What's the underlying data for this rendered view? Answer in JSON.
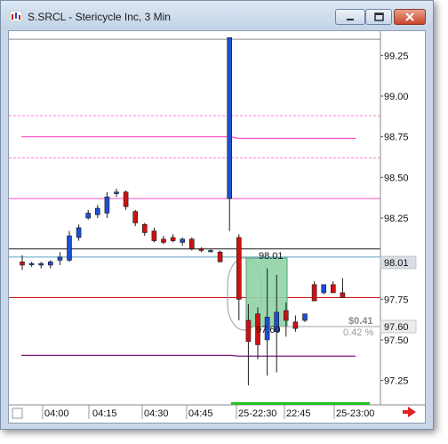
{
  "window": {
    "title": "S.SRCL - Stericycle Inc, 3 Min"
  },
  "price_axis": {
    "ticks": [
      "99.25",
      "99.00",
      "98.75",
      "98.50",
      "98.25",
      "97.75",
      "97.50",
      "97.25"
    ],
    "tick_values": [
      99.25,
      99.0,
      98.75,
      98.5,
      98.25,
      97.75,
      97.5,
      97.25
    ],
    "current_price": "98.01",
    "current_value": 98.01,
    "marker_price": "97.60",
    "marker_value": 97.6
  },
  "time_axis": {
    "labels": [
      "04:00",
      "04:15",
      "04:30",
      "04:45",
      "25-22:30",
      "22:45",
      "25-23:00"
    ]
  },
  "measure": {
    "price_label": "98.01",
    "end_label": "97.60",
    "change_label": "$0.41",
    "percent_label": "0.42 %"
  },
  "colors": {
    "up": "#1f4fcf",
    "down": "#cc1111",
    "magenta_line": "#ff4cc4",
    "red_line": "#cc1111",
    "purple_line": "#7b1a7b",
    "measure_fill": "#8fd3a6"
  },
  "chart_data": {
    "type": "candlestick",
    "title": "S.SRCL - Stericycle Inc, 3 Min",
    "ylim": [
      97.1,
      99.4
    ],
    "candles": [
      {
        "o": 97.98,
        "h": 98.02,
        "l": 97.93,
        "c": 97.96
      },
      {
        "o": 97.97,
        "h": 97.98,
        "l": 97.95,
        "c": 97.97
      },
      {
        "o": 97.96,
        "h": 97.98,
        "l": 97.94,
        "c": 97.97
      },
      {
        "o": 97.96,
        "h": 97.99,
        "l": 97.94,
        "c": 97.98
      },
      {
        "o": 97.99,
        "h": 98.04,
        "l": 97.96,
        "c": 98.01
      },
      {
        "o": 97.99,
        "h": 98.17,
        "l": 97.98,
        "c": 98.14
      },
      {
        "o": 98.13,
        "h": 98.21,
        "l": 98.11,
        "c": 98.19
      },
      {
        "o": 98.25,
        "h": 98.3,
        "l": 98.24,
        "c": 98.28
      },
      {
        "o": 98.27,
        "h": 98.33,
        "l": 98.25,
        "c": 98.31
      },
      {
        "o": 98.28,
        "h": 98.41,
        "l": 98.25,
        "c": 98.38
      },
      {
        "o": 98.4,
        "h": 98.43,
        "l": 98.38,
        "c": 98.41
      },
      {
        "o": 98.41,
        "h": 98.42,
        "l": 98.3,
        "c": 98.32
      },
      {
        "o": 98.29,
        "h": 98.3,
        "l": 98.2,
        "c": 98.22
      },
      {
        "o": 98.21,
        "h": 98.22,
        "l": 98.14,
        "c": 98.16
      },
      {
        "o": 98.17,
        "h": 98.19,
        "l": 98.1,
        "c": 98.11
      },
      {
        "o": 98.12,
        "h": 98.14,
        "l": 98.09,
        "c": 98.1
      },
      {
        "o": 98.13,
        "h": 98.15,
        "l": 98.1,
        "c": 98.11
      },
      {
        "o": 98.1,
        "h": 98.13,
        "l": 98.08,
        "c": 98.12
      },
      {
        "o": 98.12,
        "h": 98.13,
        "l": 98.05,
        "c": 98.06
      },
      {
        "o": 98.06,
        "h": 98.07,
        "l": 98.04,
        "c": 98.05
      },
      {
        "o": 98.05,
        "h": 98.06,
        "l": 98.04,
        "c": 98.05
      },
      {
        "o": 98.04,
        "h": 98.05,
        "l": 97.98,
        "c": 97.98
      },
      {
        "o": 98.37,
        "h": 99.36,
        "l": 98.17,
        "c": 99.36
      },
      {
        "o": 98.13,
        "h": 98.15,
        "l": 97.62,
        "c": 97.75
      },
      {
        "o": 97.62,
        "h": 97.72,
        "l": 97.22,
        "c": 97.49
      },
      {
        "o": 97.66,
        "h": 97.7,
        "l": 97.38,
        "c": 97.47
      },
      {
        "o": 97.5,
        "h": 97.94,
        "l": 97.28,
        "c": 97.64
      },
      {
        "o": 97.55,
        "h": 97.9,
        "l": 97.3,
        "c": 97.67
      },
      {
        "o": 97.68,
        "h": 97.73,
        "l": 97.52,
        "c": 97.62
      },
      {
        "o": 97.61,
        "h": 97.65,
        "l": 97.55,
        "c": 97.57
      },
      {
        "o": 97.62,
        "h": 97.66,
        "l": 97.61,
        "c": 97.66
      },
      {
        "o": 97.84,
        "h": 97.86,
        "l": 97.74,
        "c": 97.74
      },
      {
        "o": 97.79,
        "h": 97.84,
        "l": 97.78,
        "c": 97.84
      },
      {
        "o": 97.84,
        "h": 97.86,
        "l": 97.79,
        "c": 97.79
      },
      {
        "o": 97.79,
        "h": 97.88,
        "l": 97.76,
        "c": 97.76
      }
    ],
    "horizontal_lines": [
      {
        "value": 99.35,
        "color": "#8c8c8c"
      },
      {
        "value": 98.88,
        "color": "#ff7fd6",
        "dashed": true
      },
      {
        "value": 98.62,
        "color": "#ff7fd6",
        "dashed": true
      },
      {
        "value": 98.37,
        "color": "#ff4cc4"
      },
      {
        "value": 98.06,
        "color": "#1b1b1b"
      },
      {
        "value": 98.01,
        "color": "#5fa3c7"
      },
      {
        "value": 97.76,
        "color": "#cc1111"
      }
    ]
  }
}
